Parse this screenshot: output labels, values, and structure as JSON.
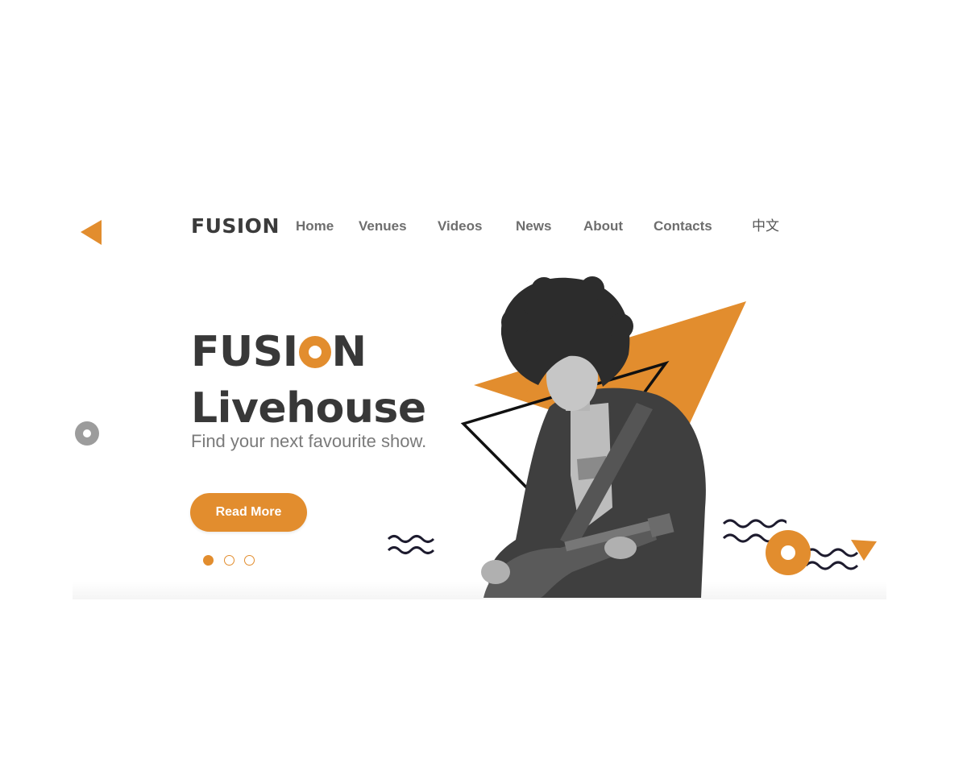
{
  "nav": {
    "logo": "FUSION",
    "items": [
      {
        "label": "Home"
      },
      {
        "label": "Venues"
      },
      {
        "label": "Videos"
      },
      {
        "label": "News"
      },
      {
        "label": "About"
      },
      {
        "label": "Contacts"
      }
    ],
    "language": "中文"
  },
  "hero": {
    "title_part1": "FUSI",
    "title_part2": "N",
    "title_line2": "Livehouse",
    "tagline": "Find your next favourite show.",
    "cta_label": "Read More",
    "slides": {
      "count": 3,
      "active_index": 0
    }
  },
  "colors": {
    "accent": "#e28d2e",
    "text_dark": "#3b3b3b",
    "text_muted": "#7a7a7a",
    "wave": "#1d1b2e",
    "ring_gray": "#9c9c9c"
  },
  "icons": {
    "back": "triangle-left-icon",
    "decor": [
      "gray-ring-icon",
      "orange-ring-icon",
      "wave-icon",
      "triangle-icon"
    ]
  }
}
